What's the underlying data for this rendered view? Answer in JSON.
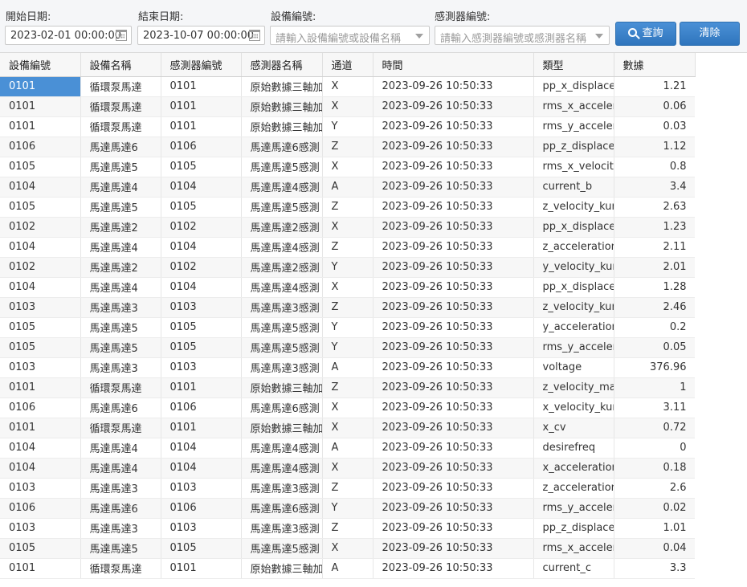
{
  "filters": {
    "start_date_label": "開始日期:",
    "start_date_value": "2023-02-01 00:00:00",
    "end_date_label": "結束日期:",
    "end_date_value": "2023-10-07 00:00:00",
    "device_label": "設備編號:",
    "device_placeholder": "請輸入設備編號或設備名稱",
    "sensor_label": "感測器編號:",
    "sensor_placeholder": "請輸入感測器編號或感測器名稱",
    "query_label": "查詢",
    "clear_label": "清除"
  },
  "colors": {
    "accent": "#3a82c9",
    "selected_cell": "#4a90d6"
  },
  "table": {
    "columns": [
      "設備編號",
      "設備名稱",
      "感測器編號",
      "感測器名稱",
      "通道",
      "時間",
      "類型",
      "數據"
    ],
    "rows": [
      [
        "0101",
        "循環泵馬達",
        "0101",
        "原始數據三軸加",
        "X",
        "2023-09-26 10:50:33",
        "pp_x_displacen",
        "1.21"
      ],
      [
        "0101",
        "循環泵馬達",
        "0101",
        "原始數據三軸加",
        "X",
        "2023-09-26 10:50:33",
        "rms_x_accelera",
        "0.06"
      ],
      [
        "0101",
        "循環泵馬達",
        "0101",
        "原始數據三軸加",
        "Y",
        "2023-09-26 10:50:33",
        "rms_y_accelera",
        "0.03"
      ],
      [
        "0106",
        "馬達馬達6",
        "0106",
        "馬達馬達6感測",
        "Z",
        "2023-09-26 10:50:33",
        "pp_z_displacen",
        "1.12"
      ],
      [
        "0105",
        "馬達馬達5",
        "0105",
        "馬達馬達5感測",
        "X",
        "2023-09-26 10:50:33",
        "rms_x_velocity_",
        "0.8"
      ],
      [
        "0104",
        "馬達馬達4",
        "0104",
        "馬達馬達4感測",
        "A",
        "2023-09-26 10:50:33",
        "current_b",
        "3.4"
      ],
      [
        "0105",
        "馬達馬達5",
        "0105",
        "馬達馬達5感測",
        "Z",
        "2023-09-26 10:50:33",
        "z_velocity_kurto",
        "2.63"
      ],
      [
        "0102",
        "馬達馬達2",
        "0102",
        "馬達馬達2感測",
        "X",
        "2023-09-26 10:50:33",
        "pp_x_displacen",
        "1.23"
      ],
      [
        "0104",
        "馬達馬達4",
        "0104",
        "馬達馬達4感測",
        "Z",
        "2023-09-26 10:50:33",
        "z_acceleration_",
        "2.11"
      ],
      [
        "0102",
        "馬達馬達2",
        "0102",
        "馬達馬達2感測",
        "Y",
        "2023-09-26 10:50:33",
        "y_velocity_kurto",
        "2.01"
      ],
      [
        "0104",
        "馬達馬達4",
        "0104",
        "馬達馬達4感測",
        "X",
        "2023-09-26 10:50:33",
        "pp_x_displacen",
        "1.28"
      ],
      [
        "0103",
        "馬達馬達3",
        "0103",
        "馬達馬達3感測",
        "Z",
        "2023-09-26 10:50:33",
        "z_velocity_kurto",
        "2.46"
      ],
      [
        "0105",
        "馬達馬達5",
        "0105",
        "馬達馬達5感測",
        "Y",
        "2023-09-26 10:50:33",
        "y_acceleration_",
        "0.2"
      ],
      [
        "0105",
        "馬達馬達5",
        "0105",
        "馬達馬達5感測",
        "Y",
        "2023-09-26 10:50:33",
        "rms_y_accelera",
        "0.05"
      ],
      [
        "0103",
        "馬達馬達3",
        "0103",
        "馬達馬達3感測",
        "A",
        "2023-09-26 10:50:33",
        "voltage",
        "376.96"
      ],
      [
        "0101",
        "循環泵馬達",
        "0101",
        "原始數據三軸加",
        "Z",
        "2023-09-26 10:50:33",
        "z_velocity_max",
        "1"
      ],
      [
        "0106",
        "馬達馬達6",
        "0106",
        "馬達馬達6感測",
        "X",
        "2023-09-26 10:50:33",
        "x_velocity_kurto",
        "3.11"
      ],
      [
        "0101",
        "循環泵馬達",
        "0101",
        "原始數據三軸加",
        "X",
        "2023-09-26 10:50:33",
        "x_cv",
        "0.72"
      ],
      [
        "0104",
        "馬達馬達4",
        "0104",
        "馬達馬達4感測",
        "A",
        "2023-09-26 10:50:33",
        "desirefreq",
        "0"
      ],
      [
        "0104",
        "馬達馬達4",
        "0104",
        "馬達馬達4感測",
        "X",
        "2023-09-26 10:50:33",
        "x_acceleration_",
        "0.18"
      ],
      [
        "0103",
        "馬達馬達3",
        "0103",
        "馬達馬達3感測",
        "Z",
        "2023-09-26 10:50:33",
        "z_acceleration_",
        "2.6"
      ],
      [
        "0106",
        "馬達馬達6",
        "0106",
        "馬達馬達6感測",
        "Y",
        "2023-09-26 10:50:33",
        "rms_y_accelera",
        "0.02"
      ],
      [
        "0103",
        "馬達馬達3",
        "0103",
        "馬達馬達3感測",
        "Z",
        "2023-09-26 10:50:33",
        "pp_z_displacen",
        "1.01"
      ],
      [
        "0105",
        "馬達馬達5",
        "0105",
        "馬達馬達5感測",
        "X",
        "2023-09-26 10:50:33",
        "rms_x_accelera",
        "0.04"
      ],
      [
        "0101",
        "循環泵馬達",
        "0101",
        "原始數據三軸加",
        "A",
        "2023-09-26 10:50:33",
        "current_c",
        "3.3"
      ]
    ]
  }
}
